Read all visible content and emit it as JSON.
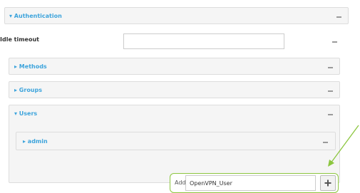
{
  "authentication": {
    "title": "▾ Authentication"
  },
  "idle_timeout": {
    "label": "Idle timeout",
    "value": ""
  },
  "methods": {
    "title": "▸ Methods"
  },
  "groups": {
    "title": "▸ Groups"
  },
  "users": {
    "title": "▾ Users",
    "admin": {
      "title": "▸ admin"
    },
    "add": {
      "label": "Add",
      "value": "OpenVPN_User"
    }
  },
  "icons": {
    "collapse": "minus-icon",
    "add": "plus-icon",
    "callout": "arrow-icon"
  },
  "colors": {
    "accent": "#3da4dc",
    "highlight": "#8cc63f"
  }
}
